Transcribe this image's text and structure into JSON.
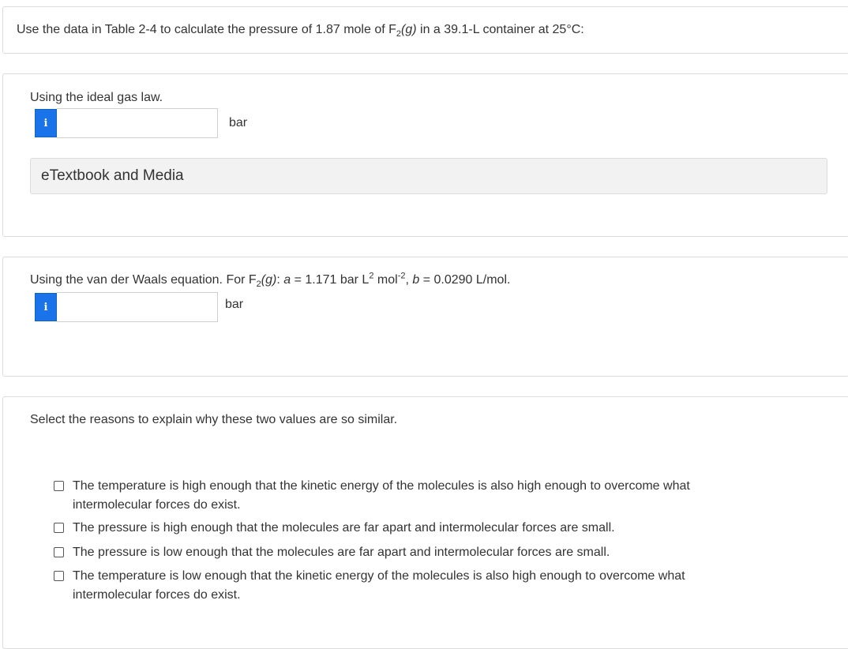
{
  "question": {
    "pre": "Use the data in Table 2-4 to calculate the pressure of 1.87 mole of F",
    "sub": "2",
    "italic": "(g)",
    "post": " in a 39.1-L container at 25°C:"
  },
  "ideal": {
    "label": "Using the ideal gas law.",
    "input_value": "",
    "unit": "bar",
    "info_glyph": "i",
    "info_icon": "info-icon",
    "media_label": "eTextbook and Media"
  },
  "vdw": {
    "pre": "Using the van der Waals equation. For F",
    "sub": "2",
    "italic_g": "(g)",
    "colon": ": ",
    "a_var": "a",
    "a_eq": " = 1.171 bar L",
    "a_sup1": "2",
    "a_mol": " mol",
    "a_sup2": "-2",
    "comma": ", ",
    "b_var": "b",
    "b_eq": " = 0.0290 L/mol.",
    "input_value": "",
    "unit": "bar",
    "info_glyph": "i",
    "info_icon": "info-icon"
  },
  "reasons": {
    "prompt": "Select the reasons to explain why these two values are so similar.",
    "options": [
      {
        "line1": "The temperature is high enough that the kinetic energy of the molecules is also high enough to overcome what",
        "line2": "intermolecular forces do exist.",
        "checked": false
      },
      {
        "line1": "The pressure is high enough that the molecules are far apart and intermolecular forces are small.",
        "line2": "",
        "checked": false
      },
      {
        "line1": "The pressure is low enough that the molecules are far apart and intermolecular forces are small.",
        "line2": "",
        "checked": false
      },
      {
        "line1": "The temperature is low enough that the kinetic energy of the molecules is also high enough to overcome what",
        "line2": "intermolecular forces do exist.",
        "checked": false
      }
    ]
  },
  "colors": {
    "info_button": "#1a73e8",
    "panel_border": "#dcdcdc",
    "media_bg": "#f2f2f2",
    "text": "#333333"
  }
}
